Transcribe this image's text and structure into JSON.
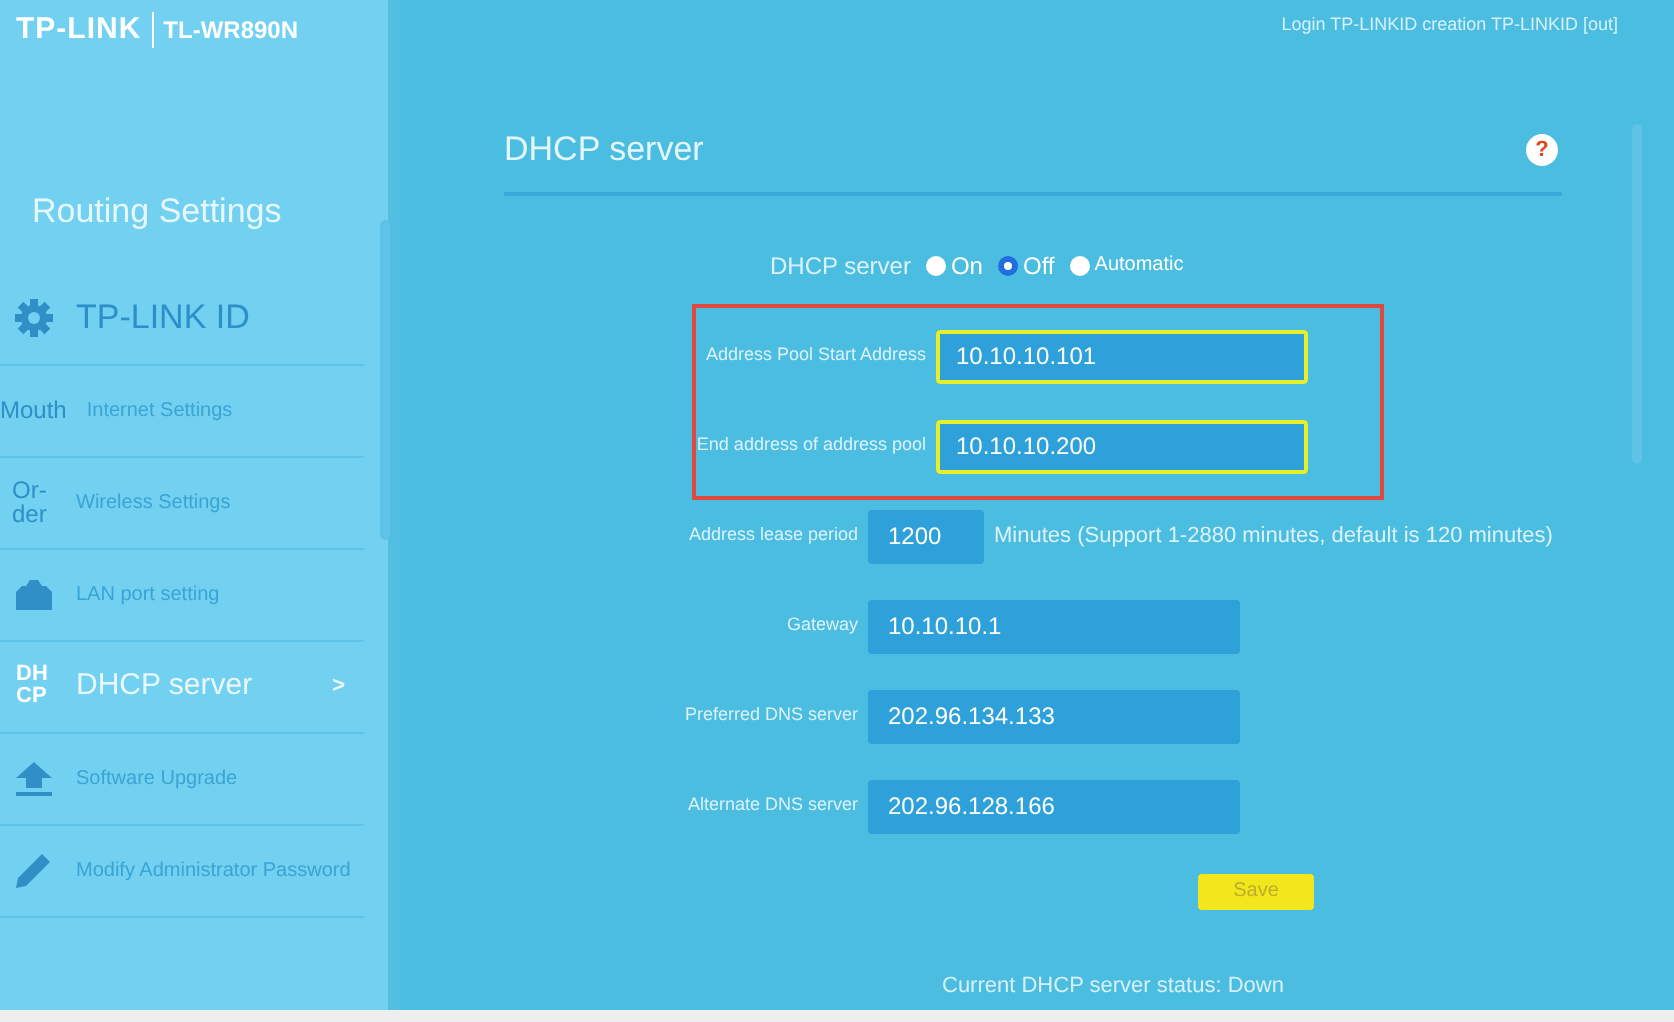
{
  "header": {
    "brand": "TP-LINK",
    "model": "TL-WR890N",
    "account_links": "Login TP-LINKID creation TP-LINKID [out]"
  },
  "sidebar": {
    "title": "Routing Settings",
    "items": [
      {
        "kind": "gear",
        "label": "TP-LINK ID",
        "selected": false
      },
      {
        "kind": "glyph",
        "glyph": "Mouth",
        "label": "Internet Settings",
        "selected": false
      },
      {
        "kind": "glyph",
        "glyph": "Or-der",
        "label": "Wireless Settings",
        "selected": false
      },
      {
        "kind": "lan",
        "label": "LAN port setting",
        "selected": false
      },
      {
        "kind": "dhcp",
        "glyph": "DHCP",
        "label": "DHCP server",
        "chevron": ">",
        "selected": true
      },
      {
        "kind": "upload",
        "label": "Software Upgrade",
        "selected": false
      },
      {
        "kind": "pencil",
        "label": "Modify Administrator Password",
        "selected": false
      }
    ]
  },
  "panel": {
    "title": "DHCP server",
    "help": "?",
    "mode": {
      "label": "DHCP server",
      "options": [
        {
          "label": "On",
          "selected": false
        },
        {
          "label": "Off",
          "selected": true
        },
        {
          "label": "Automatic",
          "selected": false
        }
      ]
    },
    "boxed_fields": [
      {
        "label": "Address Pool Start Address",
        "value": "10.10.10.101",
        "outlined": true
      },
      {
        "label": "End address of address pool",
        "value": "10.10.10.200",
        "outlined": true
      }
    ],
    "fields": [
      {
        "label": "Address lease period",
        "value": "1200",
        "short": true,
        "note": "Minutes (Support 1-2880 minutes, default is 120 minutes)"
      },
      {
        "label": "Gateway",
        "value": "10.10.10.1"
      },
      {
        "label": "Preferred DNS server",
        "value": "202.96.134.133"
      },
      {
        "label": "Alternate DNS server",
        "value": "202.96.128.166"
      }
    ],
    "save": "Save",
    "status": "Current DHCP server status: Down"
  }
}
